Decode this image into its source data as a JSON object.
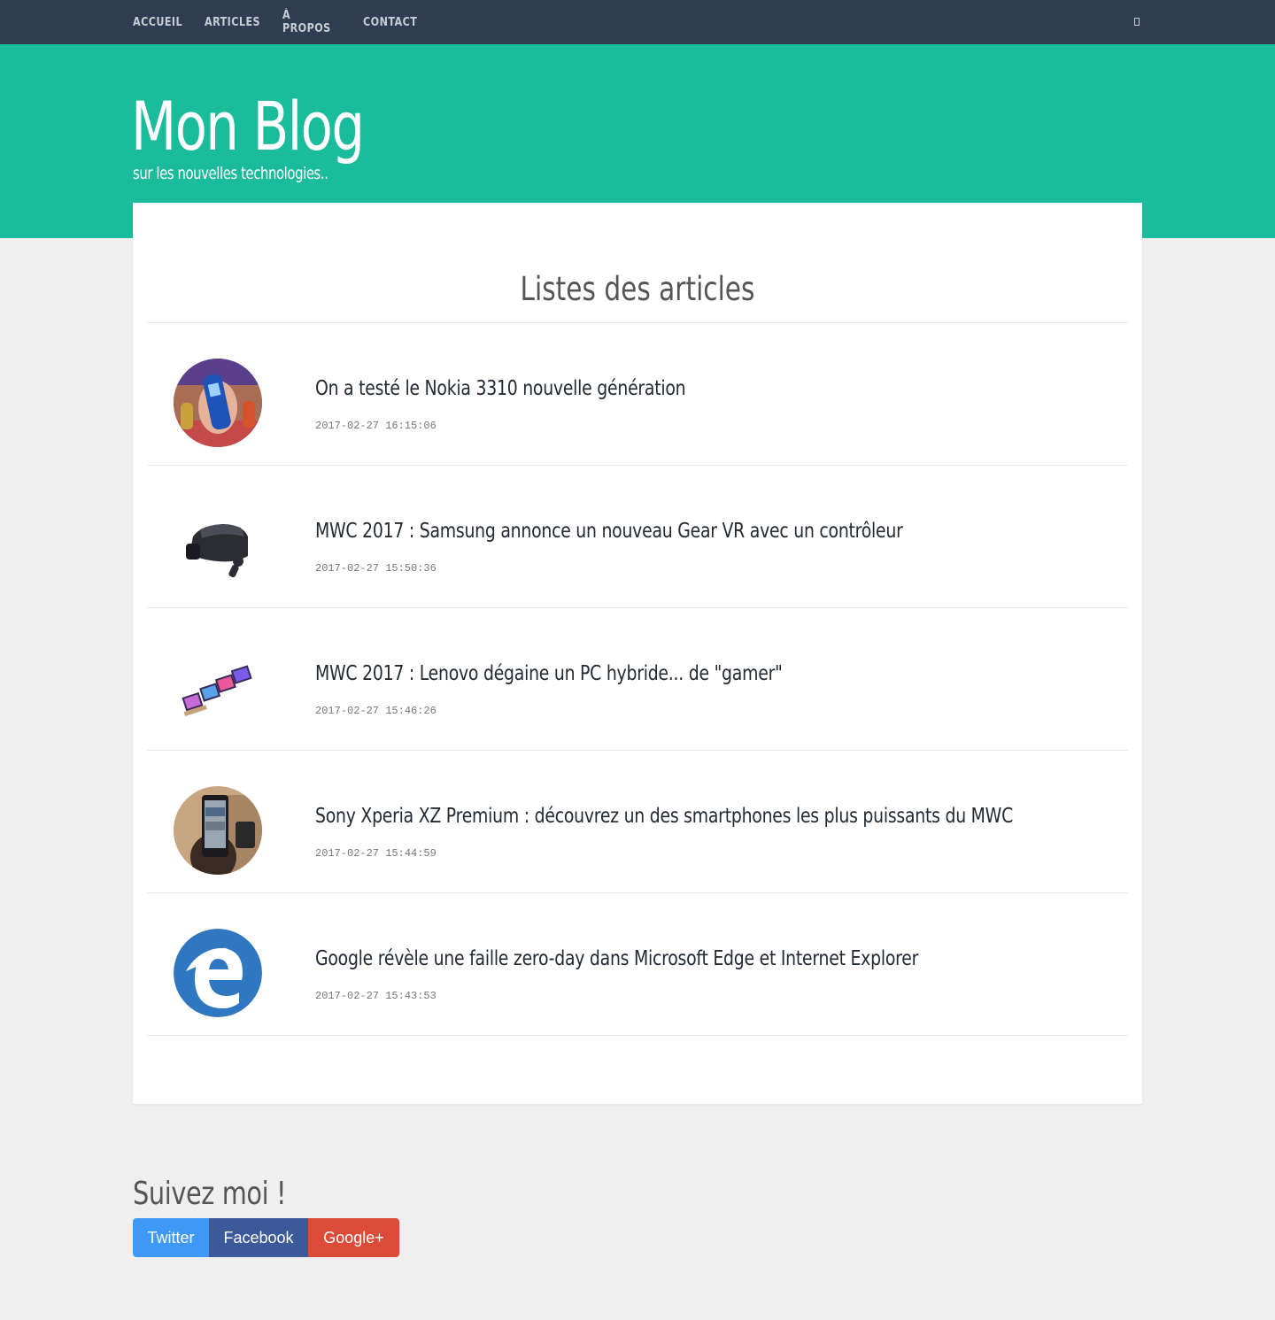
{
  "nav": {
    "links": [
      "ACCUEIL",
      "ARTICLES",
      "À PROPOS",
      "CONTACT"
    ],
    "toggle_icon": "menu-toggle-icon"
  },
  "header": {
    "title": "Mon Blog",
    "subtitle": "sur les nouvelles technologies.."
  },
  "main": {
    "heading": "Listes des articles",
    "articles": [
      {
        "title": "On a testé le Nokia 3310 nouvelle génération",
        "date": "2017-02-27 16:15:06",
        "thumbnail": "nokia-3310-thumbnail"
      },
      {
        "title": "MWC 2017 : Samsung annonce un nouveau Gear VR avec un contrôleur",
        "date": "2017-02-27 15:50:36",
        "thumbnail": "gear-vr-thumbnail"
      },
      {
        "title": "MWC 2017 : Lenovo dégaine un PC hybride... de \"gamer\"",
        "date": "2017-02-27 15:46:26",
        "thumbnail": "lenovo-laptops-thumbnail"
      },
      {
        "title": "Sony Xperia XZ Premium : découvrez un des smartphones les plus puissants du MWC",
        "date": "2017-02-27 15:44:59",
        "thumbnail": "xperia-phone-thumbnail"
      },
      {
        "title": "Google révèle une faille zero-day dans Microsoft Edge et Internet Explorer",
        "date": "2017-02-27 15:43:53",
        "thumbnail": "edge-logo-thumbnail"
      }
    ]
  },
  "footer": {
    "heading": "Suivez moi !",
    "buttons": [
      "Twitter",
      "Facebook",
      "Google+"
    ]
  },
  "colors": {
    "navbar": "#2e3d51",
    "header": "#1abc9c",
    "background": "#efefef",
    "twitter": "#3e98f6",
    "facebook": "#3c5a99",
    "google": "#dc4a38"
  }
}
